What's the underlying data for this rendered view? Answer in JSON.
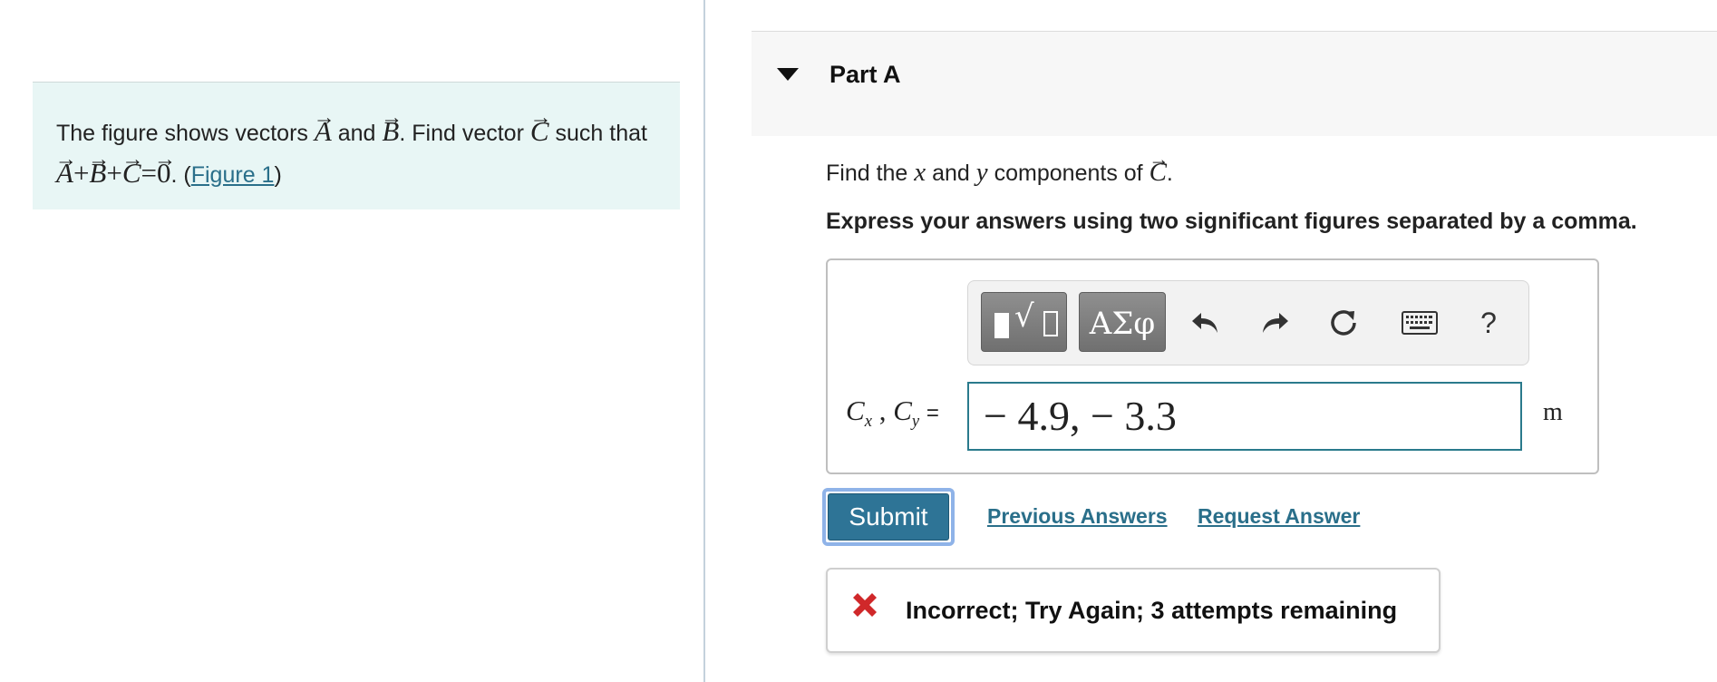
{
  "problem": {
    "text_1": "The figure shows vectors",
    "vec_a": "A",
    "text_and": "and",
    "vec_b": "B",
    "text_2": ". Find vector",
    "vec_c": "C",
    "text_3": "such that",
    "eq_plus": "+",
    "eq_equals": "=",
    "eq_zero": "0",
    "text_4": ". (",
    "figure_link": "Figure 1",
    "text_5": ")"
  },
  "part": {
    "title": "Part A"
  },
  "question": {
    "text_1": "Find the",
    "var_x": "x",
    "text_and": "and",
    "var_y": "y",
    "text_2": "components of",
    "vec_c": "C",
    "text_end": "."
  },
  "instruction": "Express your answers using two significant figures separated by a comma.",
  "toolbar": {
    "templates_icon": "templates-icon",
    "symbols_label": "ΑΣφ",
    "help_label": "?"
  },
  "answer": {
    "label_c": "C",
    "label_x": "x",
    "label_sep": " , ",
    "label_y": "y",
    "label_eq": "=",
    "value": "− 4.9, − 3.3",
    "unit": "m"
  },
  "actions": {
    "submit": "Submit",
    "previous_answers": "Previous Answers",
    "request_answer": "Request Answer"
  },
  "feedback": {
    "message": "Incorrect; Try Again; 3 attempts remaining",
    "icon": "x-icon",
    "icon_color": "#d0282a"
  },
  "colors": {
    "accent": "#2e7496",
    "link": "#2a6f8a",
    "panel_bg": "#e8f6f5"
  }
}
